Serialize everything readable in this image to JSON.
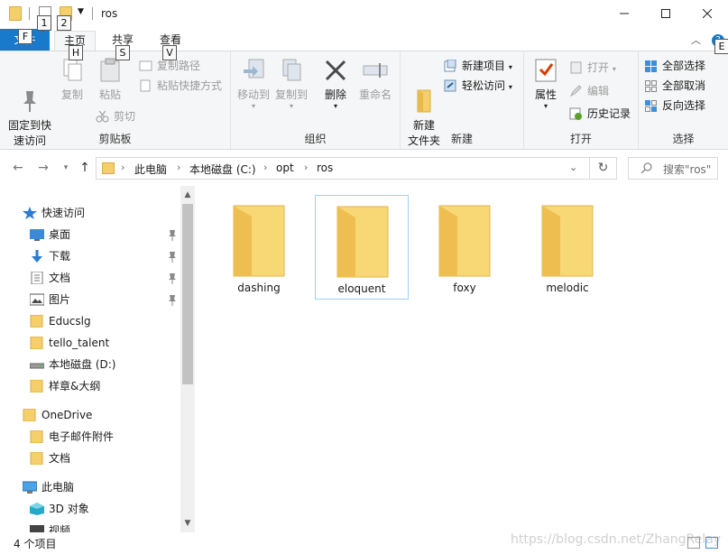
{
  "window": {
    "title": "ros",
    "keytips": [
      "1",
      "2",
      "F",
      "H",
      "S",
      "V",
      "E"
    ]
  },
  "ribbon_tabs": {
    "file": "文件",
    "home": "主页",
    "share": "共享",
    "view": "查看"
  },
  "ribbon": {
    "clipboard": {
      "label": "剪贴板",
      "pin_quick": "固定到快\n速访问",
      "copy": "复制",
      "paste": "粘贴",
      "copy_path": "复制路径",
      "paste_shortcut": "粘贴快捷方式",
      "cut": "剪切"
    },
    "organize": {
      "label": "组织",
      "move_to": "移动到",
      "copy_to": "复制到",
      "delete": "删除",
      "rename": "重命名"
    },
    "new": {
      "label": "新建",
      "new_folder": "新建\n文件夹",
      "new_item": "新建项目",
      "easy_access": "轻松访问"
    },
    "open": {
      "label": "打开",
      "properties": "属性",
      "open": "打开",
      "edit": "编辑",
      "history": "历史记录"
    },
    "select": {
      "label": "选择",
      "select_all": "全部选择",
      "select_none": "全部取消",
      "invert": "反向选择"
    }
  },
  "address": {
    "crumbs": [
      "此电脑",
      "本地磁盘 (C:)",
      "opt",
      "ros"
    ],
    "search_placeholder": "搜索\"ros\""
  },
  "sidebar": {
    "items": [
      {
        "label": "快速访问",
        "icon": "star-icon"
      },
      {
        "label": "桌面",
        "icon": "desktop-icon"
      },
      {
        "label": "下载",
        "icon": "download-icon"
      },
      {
        "label": "文档",
        "icon": "document-icon"
      },
      {
        "label": "图片",
        "icon": "picture-icon"
      },
      {
        "label": "Educslg",
        "icon": "folder-icon"
      },
      {
        "label": "tello_talent",
        "icon": "folder-icon"
      },
      {
        "label": "本地磁盘 (D:)",
        "icon": "drive-icon"
      },
      {
        "label": "样章&大纲",
        "icon": "folder-icon"
      },
      {
        "label": "OneDrive",
        "icon": "folder-icon"
      },
      {
        "label": "电子邮件附件",
        "icon": "folder-icon"
      },
      {
        "label": "文档",
        "icon": "folder-icon"
      },
      {
        "label": "此电脑",
        "icon": "computer-icon"
      },
      {
        "label": "3D 对象",
        "icon": "3d-objects-icon"
      },
      {
        "label": "视频",
        "icon": "video-icon"
      }
    ]
  },
  "content": {
    "folders": [
      {
        "name": "dashing",
        "selected": false
      },
      {
        "name": "eloquent",
        "selected": true
      },
      {
        "name": "foxy",
        "selected": false
      },
      {
        "name": "melodic",
        "selected": false
      }
    ]
  },
  "status": {
    "item_count": "4 个项目",
    "watermark": "https://blog.csdn.net/ZhangRelay"
  },
  "colors": {
    "accent": "#1979ca",
    "folder": "#f5cf6b",
    "selection_border": "#99d1ff"
  }
}
